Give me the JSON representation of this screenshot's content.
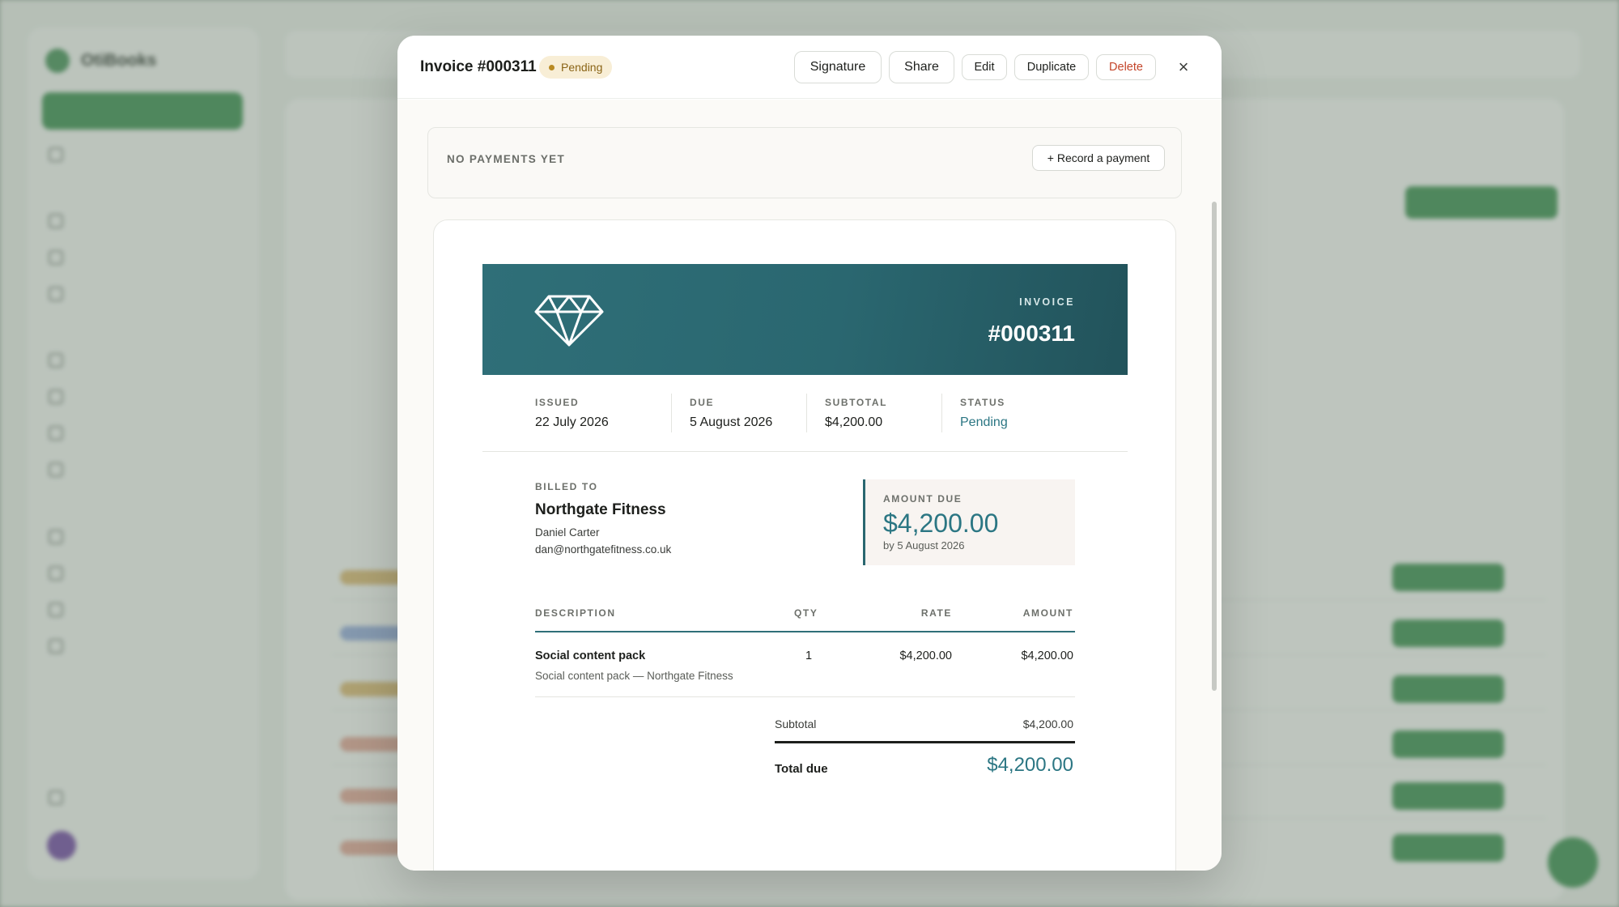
{
  "background": {
    "app_name": "OtiBooks"
  },
  "modal": {
    "title": "Invoice #000311",
    "status": "Pending",
    "buttons": {
      "signature": "Signature",
      "share": "Share",
      "edit": "Edit",
      "duplicate": "Duplicate",
      "delete": "Delete"
    },
    "close_symbol": "×"
  },
  "payments": {
    "label": "NO PAYMENTS YET",
    "record_button": "+ Record a payment"
  },
  "invoice": {
    "header_label": "INVOICE",
    "number": "#000311",
    "brand_icon": "diamond-icon",
    "meta": {
      "issued_label": "ISSUED",
      "issued": "22 July 2026",
      "due_label": "DUE",
      "due": "5 August 2026",
      "subtotal_label": "SUBTOTAL",
      "subtotal": "$4,200.00",
      "status_label": "STATUS",
      "status": "Pending"
    },
    "billed_to": {
      "label": "BILLED TO",
      "company": "Northgate Fitness",
      "contact": "Daniel Carter",
      "email": "dan@northgatefitness.co.uk"
    },
    "amount_due": {
      "label": "AMOUNT DUE",
      "amount": "$4,200.00",
      "by": "by 5 August 2026"
    },
    "table": {
      "headers": {
        "description": "DESCRIPTION",
        "qty": "QTY",
        "rate": "RATE",
        "amount": "AMOUNT"
      },
      "rows": [
        {
          "description": "Social content pack",
          "detail": "Social content pack — Northgate Fitness",
          "qty": "1",
          "rate": "$4,200.00",
          "amount": "$4,200.00"
        }
      ]
    },
    "totals": {
      "subtotal_label": "Subtotal",
      "subtotal": "$4,200.00",
      "total_label": "Total due",
      "total": "$4,200.00"
    }
  },
  "colors": {
    "accent_teal": "#2b7683",
    "banner": "#2a6770",
    "pending_bg": "#f8eed6",
    "pending_text": "#8a6416",
    "danger": "#c4452a",
    "brand_green": "#2f8845"
  }
}
